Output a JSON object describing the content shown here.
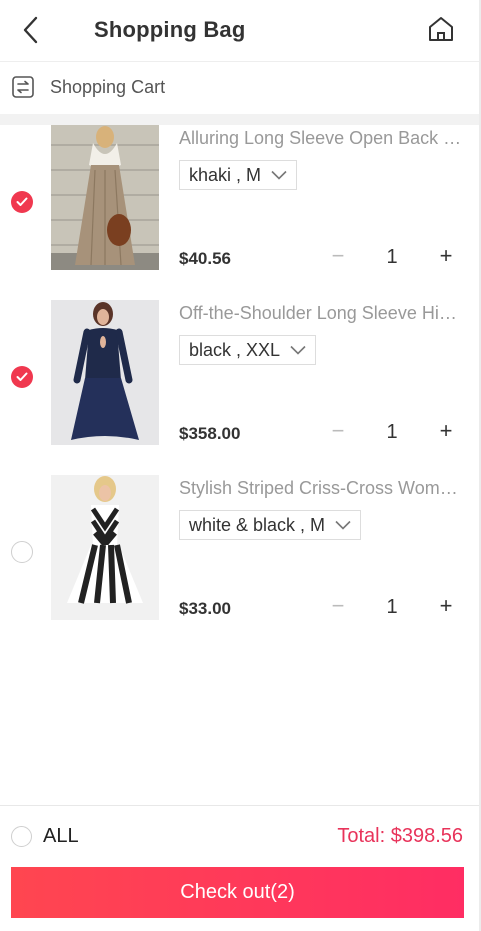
{
  "header": {
    "title": "Shopping Bag",
    "back_icon": "chevron-left-icon",
    "home_icon": "home-icon"
  },
  "subbar": {
    "label": "Shopping Cart",
    "icon": "cart-list-icon"
  },
  "items": [
    {
      "name": "Alluring Long Sleeve Open Back Maxi Dress",
      "variant": "khaki , M",
      "price": "$40.56",
      "qty": "1",
      "checked": true
    },
    {
      "name": "Off-the-Shoulder Long Sleeve High-Low Dress",
      "variant": "black , XXL",
      "price": "$358.00",
      "qty": "1",
      "checked": true
    },
    {
      "name": "Stylish Striped Criss-Cross Women's Dress",
      "variant": "white & black , M",
      "price": "$33.00",
      "qty": "1",
      "checked": false
    }
  ],
  "qty_controls": {
    "minus": "−",
    "plus": "+"
  },
  "footer": {
    "all_label": "ALL",
    "total": "Total: $398.56",
    "checkout_label": "Check out(2)"
  },
  "colors": {
    "accent": "#f0384f",
    "total_text": "#e8335a",
    "checkout_start": "#ff4650",
    "checkout_end": "#ff2d63"
  }
}
